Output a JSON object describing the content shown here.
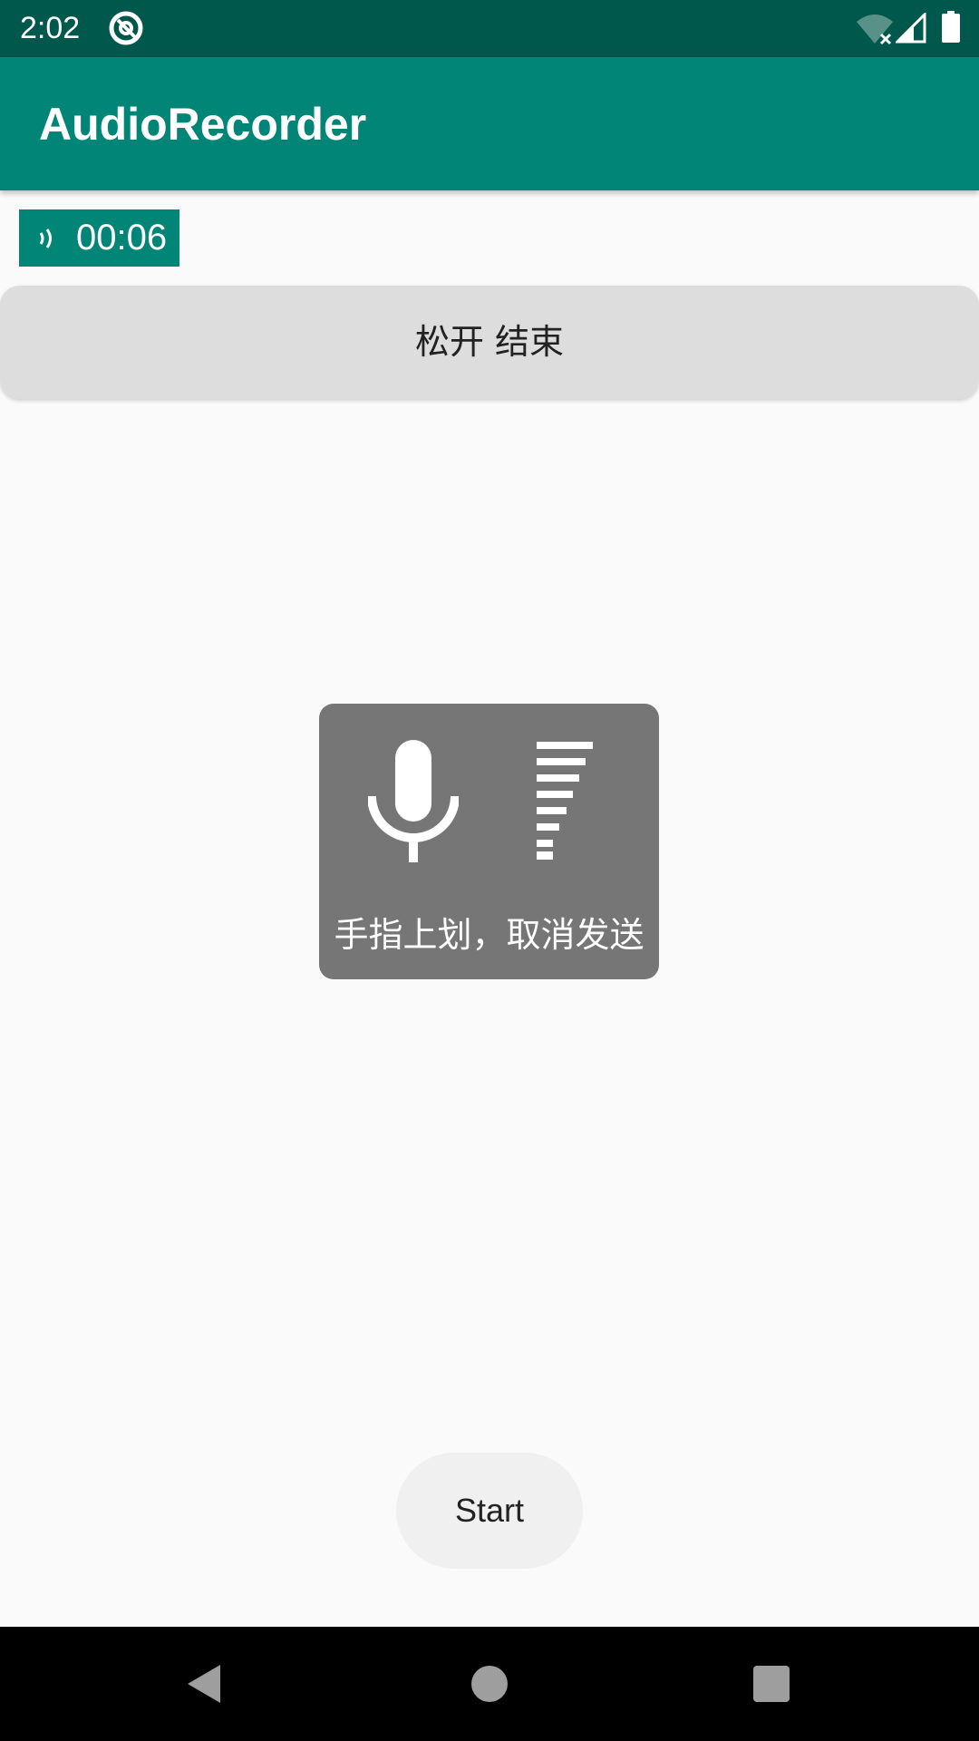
{
  "status_bar": {
    "time": "2:02",
    "icons": [
      "app-notification-icon",
      "wifi-off-icon",
      "cell-signal-icon",
      "battery-icon"
    ]
  },
  "app_bar": {
    "title": "AudioRecorder"
  },
  "recording_chip": {
    "icon": "sound-wave-icon",
    "elapsed": "00:06"
  },
  "release_button": {
    "label": "松开 结束"
  },
  "record_dialog": {
    "mic_icon": "microphone-icon",
    "level_icon": "volume-level-icon",
    "hint": "手指上划，取消发送"
  },
  "start_button": {
    "label": "Start"
  },
  "nav_bar": {
    "icons": [
      "back-icon",
      "home-icon",
      "recents-icon"
    ]
  },
  "colors": {
    "status_bar": "#00574b",
    "primary": "#008577",
    "background": "#fafafa",
    "dialog": "#767676",
    "button": "#dddddd",
    "start_button": "#f0f0f0",
    "nav_bar": "#000000"
  }
}
